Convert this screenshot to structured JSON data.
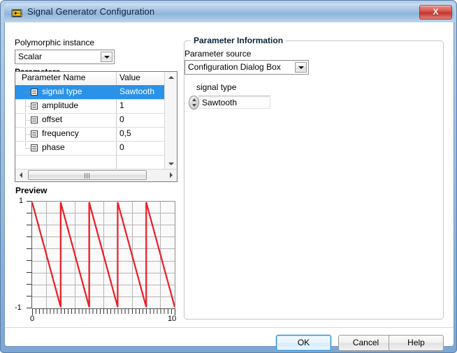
{
  "window": {
    "title": "Signal Generator Configuration",
    "icon": "labview-vi-icon",
    "close_label": "X"
  },
  "left": {
    "polymorphic_label": "Polymorphic instance",
    "polymorphic_value": "Scalar",
    "parameters_label": "Parameters",
    "table": {
      "columns": [
        "Parameter Name",
        "Value"
      ],
      "rows": [
        {
          "name": "signal type",
          "value": "Sawtooth",
          "selected": true
        },
        {
          "name": "amplitude",
          "value": "1",
          "selected": false
        },
        {
          "name": "offset",
          "value": "0",
          "selected": false
        },
        {
          "name": "frequency",
          "value": "0,5",
          "selected": false
        },
        {
          "name": "phase",
          "value": "0",
          "selected": false
        }
      ]
    },
    "preview_label": "Preview"
  },
  "right": {
    "group_title": "Parameter Information",
    "source_label": "Parameter source",
    "source_value": "Configuration Dialog Box",
    "control_label": "signal type",
    "control_value": "Sawtooth"
  },
  "buttons": {
    "ok": "OK",
    "cancel": "Cancel",
    "help": "Help"
  },
  "colors": {
    "selection": "#2a92e8",
    "waveform": "#ed1c24",
    "titlebar_text": "#10243c",
    "close_button": "#c3342b"
  },
  "chart_data": {
    "type": "line",
    "title": "Preview",
    "xlabel": "",
    "ylabel": "",
    "xlim": [
      0,
      10
    ],
    "ylim": [
      -1,
      1
    ],
    "xticks": [
      0,
      10
    ],
    "xtick_labels": [
      "0",
      "10"
    ],
    "yticks": [
      -1,
      1
    ],
    "ytick_labels": [
      "-1",
      "1"
    ],
    "grid": true,
    "x_gridlines": 10,
    "y_gridlines": 9,
    "series": [
      {
        "name": "Sawtooth",
        "color": "#ed1c24",
        "waveform": "sawtooth-falling",
        "amplitude": 1,
        "offset": 0,
        "frequency": 0.5,
        "phase": 0,
        "period": 2,
        "cycles": 5,
        "x": [
          0,
          2,
          2,
          4,
          4,
          6,
          6,
          8,
          8,
          10
        ],
        "y": [
          1,
          -1,
          1,
          -1,
          1,
          -1,
          1,
          -1,
          1,
          -1
        ]
      }
    ]
  }
}
